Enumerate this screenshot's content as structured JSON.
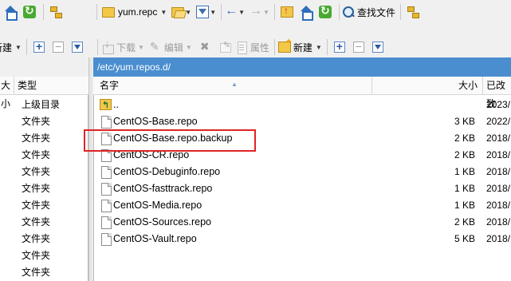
{
  "toolbar_top": {
    "path_combo_value": "yum.repc",
    "find_files_label": "查找文件"
  },
  "toolbar_second": {
    "left_new_label": "新建",
    "download_label": "下载",
    "edit_label": "编辑",
    "properties_label": "属性",
    "right_new_label": "新建"
  },
  "remote_path": "/etc/yum.repos.d/",
  "left_panel": {
    "columns": [
      "大小",
      "类型"
    ],
    "rows": [
      "上级目录",
      "文件夹",
      "文件夹",
      "文件夹",
      "文件夹",
      "文件夹",
      "文件夹",
      "文件夹",
      "文件夹",
      "文件夹",
      "文件夹"
    ]
  },
  "right_panel": {
    "columns": {
      "name": "名字",
      "size": "大小",
      "modified": "已改致"
    },
    "files": [
      {
        "name": "..",
        "size": "",
        "date": "2023/",
        "icon": "parent-folder-icon"
      },
      {
        "name": "CentOS-Base.repo",
        "size": "3 KB",
        "date": "2022/",
        "icon": "file-icon"
      },
      {
        "name": "CentOS-Base.repo.backup",
        "size": "2 KB",
        "date": "2018/",
        "icon": "file-icon"
      },
      {
        "name": "CentOS-CR.repo",
        "size": "2 KB",
        "date": "2018/",
        "icon": "file-icon"
      },
      {
        "name": "CentOS-Debuginfo.repo",
        "size": "1 KB",
        "date": "2018/",
        "icon": "file-icon"
      },
      {
        "name": "CentOS-fasttrack.repo",
        "size": "1 KB",
        "date": "2018/",
        "icon": "file-icon"
      },
      {
        "name": "CentOS-Media.repo",
        "size": "1 KB",
        "date": "2018/",
        "icon": "file-icon"
      },
      {
        "name": "CentOS-Sources.repo",
        "size": "2 KB",
        "date": "2018/",
        "icon": "file-icon"
      },
      {
        "name": "CentOS-Vault.repo",
        "size": "5 KB",
        "date": "2018/",
        "icon": "file-icon"
      }
    ]
  },
  "colors": {
    "path_bar": "#4a8ecf",
    "highlight": "#e02424"
  }
}
